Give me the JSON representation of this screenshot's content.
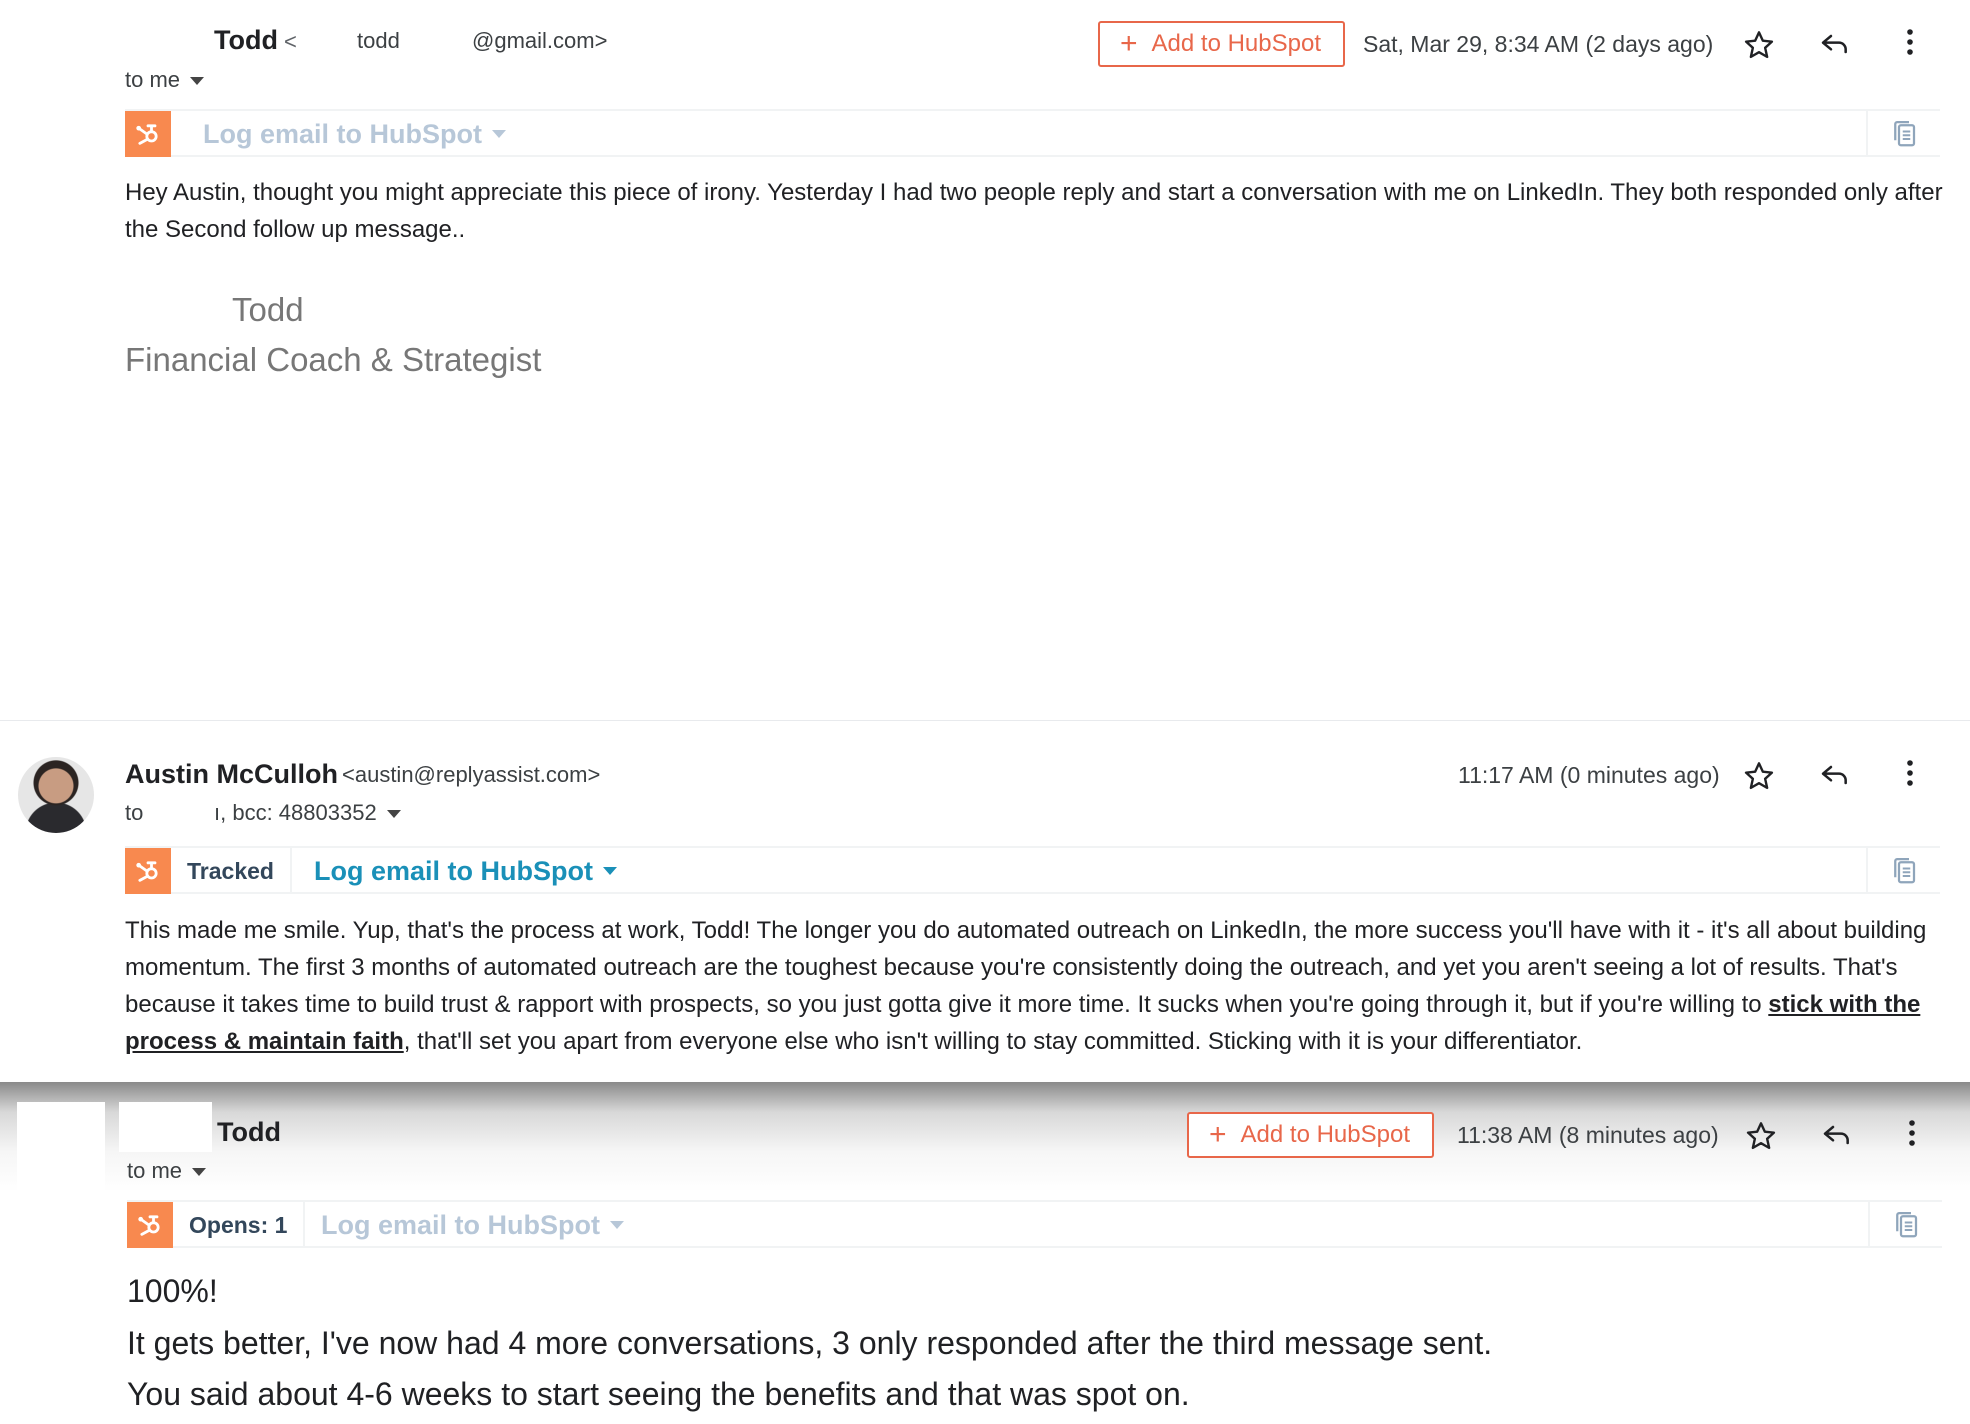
{
  "message1": {
    "sender_name": "Todd",
    "sender_email_prefix": "<",
    "sender_email_user": "todd",
    "sender_email_domain": "@gmail.com>",
    "recipient": "to me",
    "add_to_hubspot": "Add to HubSpot",
    "timestamp": "Sat, Mar 29, 8:34 AM (2 days ago)",
    "hubspot_log": "Log email to HubSpot",
    "body": "Hey Austin, thought you might appreciate this piece of irony. Yesterday I had two people reply and start a conversation with me on LinkedIn. They both responded only after the Second follow up message..",
    "signature_name": "Todd",
    "signature_title": "Financial Coach & Strategist"
  },
  "message2": {
    "sender_name": "Austin McCulloh",
    "sender_email": "<austin@replyassist.com>",
    "recipient_prefix": "to",
    "recipient_rest": "ı, bcc: 48803352",
    "timestamp": "11:17 AM (0 minutes ago)",
    "tracked_label": "Tracked",
    "hubspot_log": "Log email to HubSpot",
    "body_before_link": "This made me smile. Yup, that's the process at work, Todd! The longer you do automated outreach on LinkedIn, the more success you'll have with it - it's all about building momentum. The first 3 months of automated outreach are the toughest because you're consistently doing the outreach, and yet you aren't seeing a lot of results. That's because it takes time to build trust & rapport with prospects, so you just gotta give it more time. It sucks when you're going through it, but if you're willing to ",
    "body_link": "stick with the process & maintain faith",
    "body_after_link": ", that'll set you apart from everyone else who isn't willing to stay committed. Sticking with it is your differentiator."
  },
  "message3": {
    "sender_name": "Todd",
    "recipient": "to me",
    "add_to_hubspot": "Add to HubSpot",
    "timestamp": "11:38 AM (8 minutes ago)",
    "opens_label": "Opens: 1",
    "hubspot_log": "Log email to HubSpot",
    "line1": "100%!",
    "line2": "It gets better, I've now had 4 more conversations, 3 only responded after the third message sent.",
    "line3": "You said about 4-6 weeks to start seeing the benefits and that was spot on."
  },
  "colors": {
    "hubspot_orange": "#f8894f",
    "hubspot_button": "#e8674a",
    "hubspot_link_active": "#1a90b8",
    "hubspot_link_dim": "#b7c7d8"
  }
}
